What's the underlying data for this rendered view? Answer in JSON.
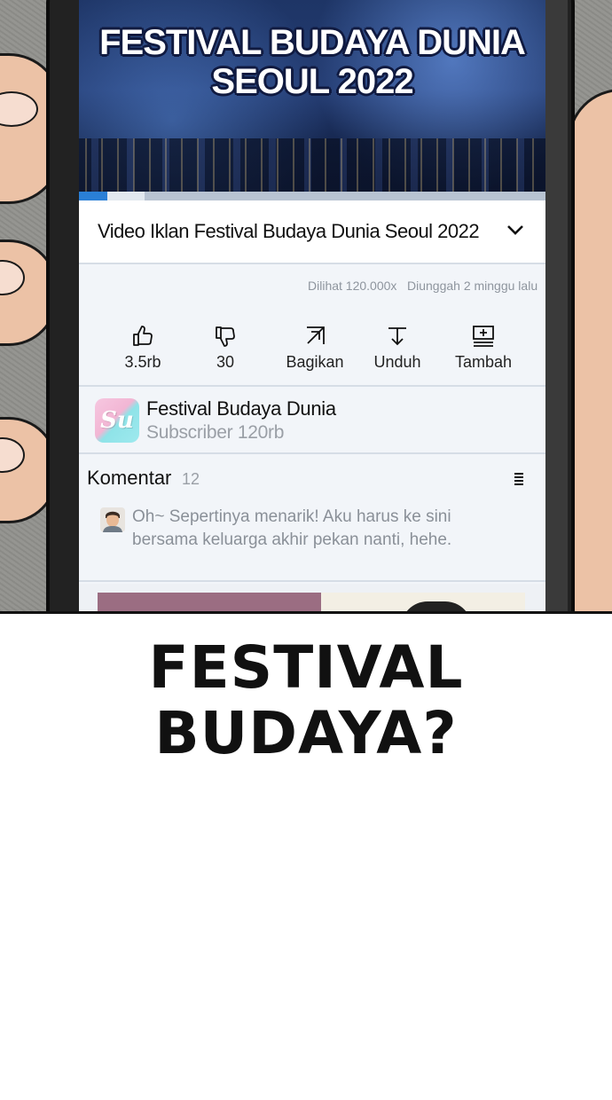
{
  "video": {
    "overlay_title_line1": "FESTIVAL BUDAYA DUNIA",
    "overlay_title_line2": "SEOUL 2022",
    "progress_fraction": 0.06,
    "buffer_fraction": 0.14,
    "title": "Video Iklan Festival Budaya Dunia Seoul 2022",
    "expand_icon": "chevron-down-icon",
    "views": "Dilihat 120.000x",
    "uploaded": "Diunggah 2 minggu lalu"
  },
  "actions": [
    {
      "icon": "thumbs-up-icon",
      "label": "3.5rb"
    },
    {
      "icon": "thumbs-down-icon",
      "label": "30"
    },
    {
      "icon": "share-icon",
      "label": "Bagikan"
    },
    {
      "icon": "download-icon",
      "label": "Unduh"
    },
    {
      "icon": "add-to-playlist-icon",
      "label": "Tambah"
    }
  ],
  "channel": {
    "logo_text": "Su",
    "name": "Festival Budaya Dunia",
    "subscribers": "Subscriber 120rb"
  },
  "comments": {
    "title": "Komentar",
    "count": "12",
    "menu_icon": "sort-menu-icon",
    "first": {
      "avatar_icon": "user-avatar-icon",
      "text": "Oh~ Sepertinya menarik! Aku harus ke sini bersama keluarga akhir pekan nanti, hehe."
    }
  },
  "caption": {
    "line1": "FESTIVAL",
    "line2": "BUDAYA?"
  },
  "colors": {
    "accent": "#2a7fd6",
    "screen_bg": "#f2f5f9",
    "muted_text": "#9a9fa6"
  }
}
